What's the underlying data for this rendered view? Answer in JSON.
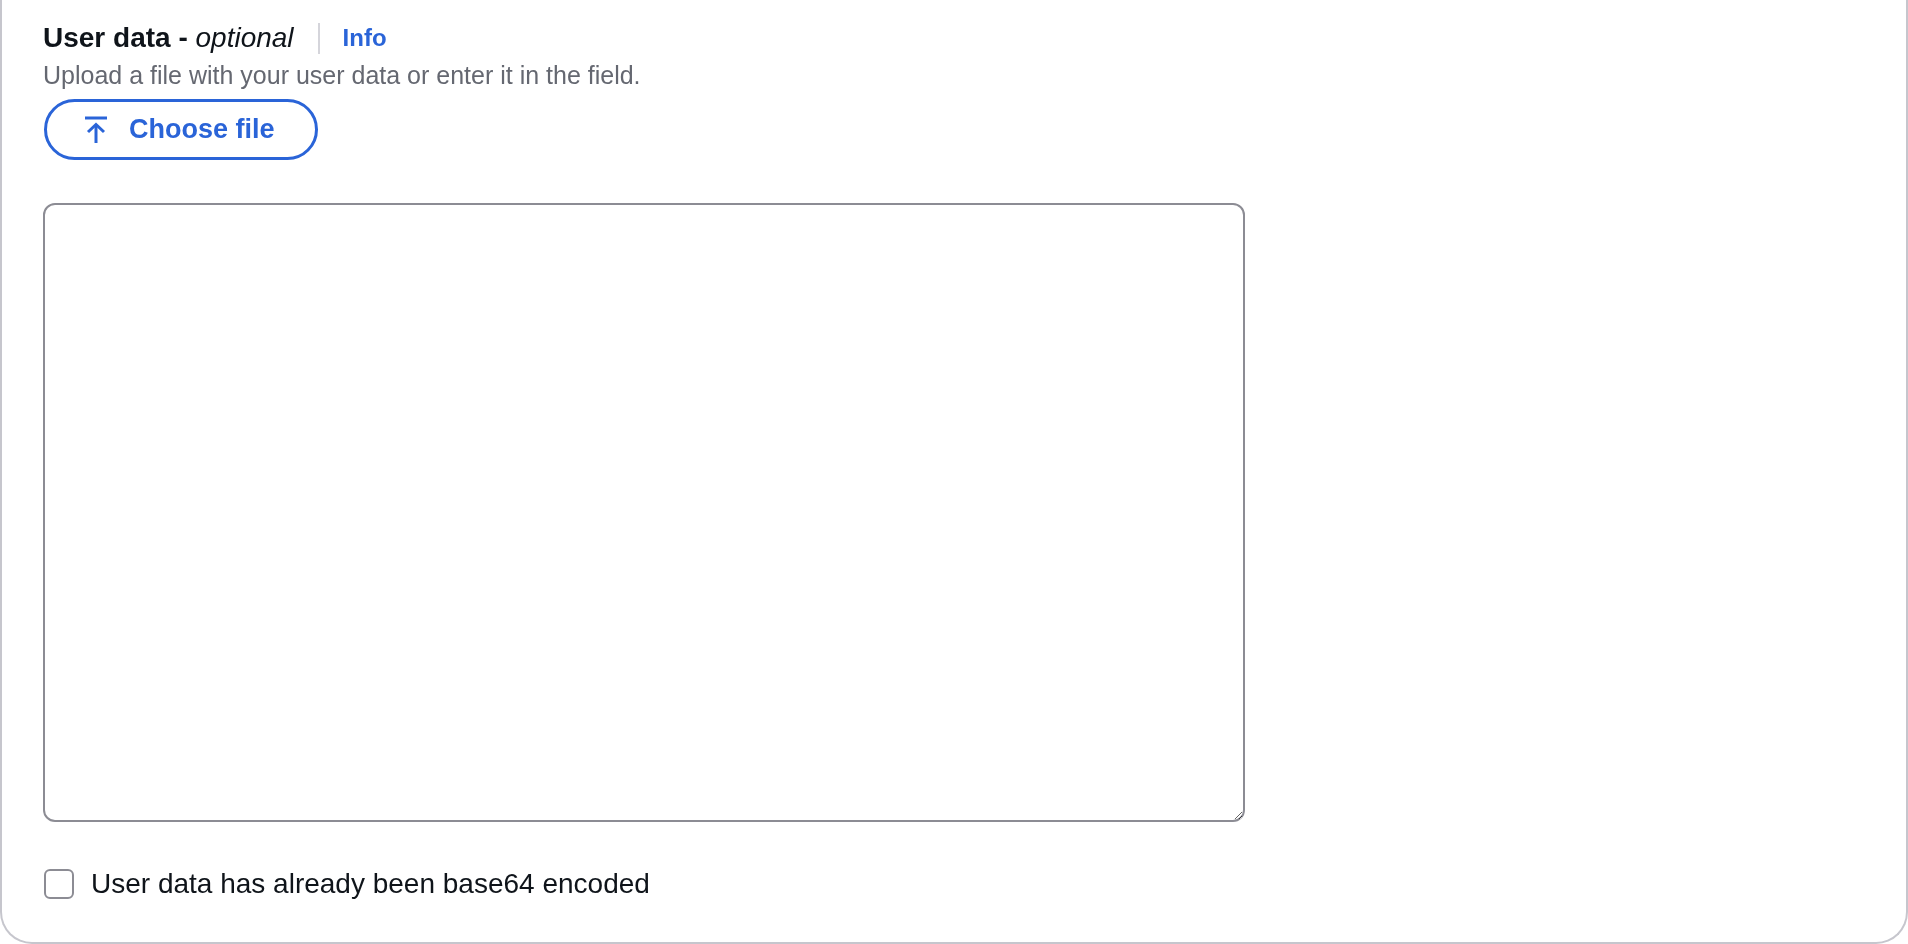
{
  "field": {
    "label": "**User data -** *optional*",
    "info_link": "Info",
    "description": "Upload a file with your user data or enter it in the field."
  },
  "upload_button": {
    "label": "Choose file"
  },
  "checkbox": {
    "label": "User data has already been base64 encoded",
    "checked": false
  }
}
